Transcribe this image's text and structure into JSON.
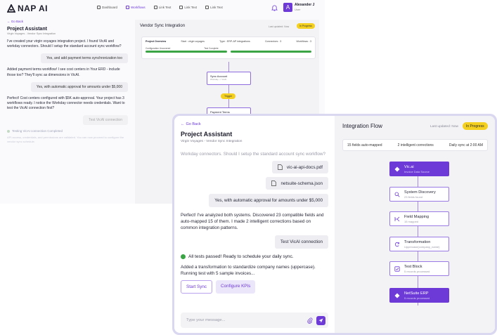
{
  "app": {
    "logo_text": "NAP AI",
    "nav": [
      {
        "label": "Dashboard",
        "active": false
      },
      {
        "label": "Workflows",
        "active": true
      },
      {
        "label": "Link Text",
        "active": false
      },
      {
        "label": "Link Text",
        "active": false
      },
      {
        "label": "Link Text",
        "active": false
      }
    ],
    "user": {
      "name": "Alexander J",
      "role": "User",
      "initial": "A"
    }
  },
  "background": {
    "chat": {
      "back_label": "Go Back",
      "title": "Project Assistant",
      "subtitle": "Virgin Voyages - Vendor Sync Integration",
      "messages": [
        {
          "type": "assistant",
          "text": "I've created your virgin voyages integration project. I found VicAI and workday connectors. Should I setup the standard account sync workflow?"
        },
        {
          "type": "user",
          "text": "Yes, and add payment terms synchronization too"
        },
        {
          "type": "assistant",
          "text": "Added payment terms workflow! I see cost centers in Your ERD - include those too? They'll sync as dimensions in VicAI."
        },
        {
          "type": "user",
          "text": "Yes, with automatic approval for amounts under $5,000"
        },
        {
          "type": "assistant",
          "text": "Perfect! Cost centers configured with $5K auto-approval. Your project has 3 workflows ready. I notice the Workday connector needs credentials. Want to test the VicAI connection first?"
        },
        {
          "type": "user_faded",
          "text": "Test VicAI connection"
        }
      ],
      "testing_status": "Testing VicAI connection Completed",
      "faint_text": "API access, credentials, and permissions are validated. You can now proceed to configure the vendor sync schedule."
    },
    "flow": {
      "title": "Vendor Sync Integration",
      "updated": "Last updated: Now",
      "status": "In Progress",
      "overview": {
        "title": "Project Overview",
        "start": "Start : virgin voyages",
        "type": "Type : ERP-AP integrations",
        "connectors": "Connectors : 3",
        "workflows": "Workflows : 3",
        "config_label": "Configuration Uncovered",
        "test_label": "Test Complete"
      },
      "node_sync": {
        "label": "Sync Account",
        "sub": "Workday -> VicAI"
      },
      "trigger": "Trigger",
      "node_payment": {
        "label": "Payment Terms",
        "sub": "Terms sync"
      }
    }
  },
  "modal": {
    "chat": {
      "back_label": "Go Back",
      "title": "Project Assistant",
      "subtitle": "Virgin Voyages - Vendor Sync Integration",
      "intro_cut": "Workday connectors. Should I setup the standard account sync workflow?",
      "files": [
        "vic-ai-api-docs.pdf",
        "netsuite-schema.json"
      ],
      "user_message": "Yes, with automatic approval for amounts under $5,000",
      "assistant_message": "Perfect! I've analyzed both systems. Discovered 23 compatible fields and auto-mapped 15 of them. I made 2 intelligent corrections based on common integration patterns.",
      "test_button": "Test VicAI connection",
      "success_text": "All tests passed! Ready to schedule your daily sync.",
      "transform_text": "Added a transformation to standardize company names (uppercase). Running test with 5 sample invoices...",
      "start_sync": "Start Sync",
      "configure_kpis": "Configure KPIs",
      "input_placeholder": "Type your message..."
    },
    "flow": {
      "title": "Integration Flow",
      "updated": "Last updated: Now",
      "status": "In Progress",
      "stats": {
        "fields": "15 fields auto-mapped",
        "corrections": "2 intelligent corrections",
        "schedule": "Daily sync at 2:00 AM"
      },
      "nodes": [
        {
          "label": "Vic.ai",
          "sub": "Invoice Data Source",
          "icon": "diamond-icon",
          "filled": true
        },
        {
          "label": "System Discovery",
          "sub": "23 fields found",
          "icon": "search-icon",
          "filled": false
        },
        {
          "label": "Field Mapping",
          "sub": "15 mapped",
          "icon": "mapping-icon",
          "filled": false
        },
        {
          "label": "Transformation",
          "sub": "Uppercase(company_name)",
          "icon": "cycle-icon",
          "filled": false
        },
        {
          "label": "Test Block",
          "sub": "5 records processed",
          "icon": "check-doc-icon",
          "filled": false
        },
        {
          "label": "NetSuite ERP",
          "sub": "5 records processed",
          "icon": "diamond-icon",
          "filled": true
        }
      ]
    }
  },
  "colors": {
    "accent": "#6d3ad8",
    "status": "#f4d021",
    "success": "#3ba545"
  }
}
